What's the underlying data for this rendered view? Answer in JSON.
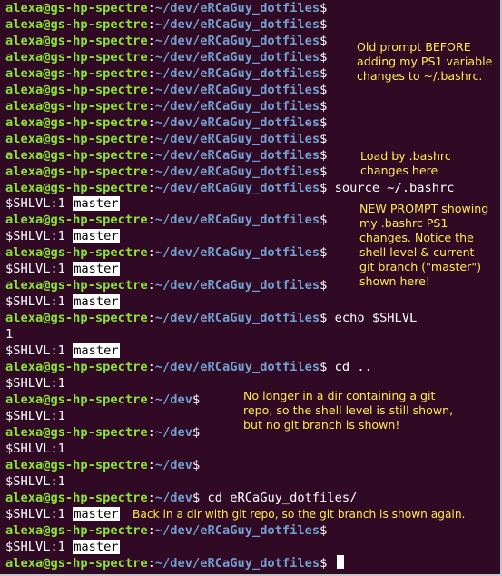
{
  "prompt": {
    "user_host": "alexa@gs-hp-spectre",
    "separator": ":",
    "path_dotfiles": "~/dev/eRCaGuy_dotfiles",
    "path_dev": "~/dev",
    "dollar": "$",
    "shlvl_label": "$SHLVL:1",
    "branch": "master"
  },
  "commands": {
    "source": "source ~/.bashrc",
    "echo": "echo $SHLVL",
    "echo_output": "1",
    "cd_up": "cd ..",
    "cd_dotfiles": "cd eRCaGuy_dotfiles/"
  },
  "annotations": {
    "old_prompt": [
      "Old prompt BEFORE",
      "adding my PS1 variable",
      "changes to ~/.bashrc."
    ],
    "load_bashrc": [
      "Load by .bashrc",
      "changes here"
    ],
    "new_prompt": [
      "NEW PROMPT showing",
      "my .bashrc PS1",
      "changes. Notice the",
      "shell level & current",
      "git branch (\"master\")",
      "shown here!"
    ],
    "no_git": [
      "No longer in a dir containing a git",
      "repo, so the shell level is still shown,",
      "but no git branch is shown!"
    ],
    "back_in_repo": "Back in a dir with git repo, so the git branch is shown again."
  },
  "colors": {
    "background": "#300a24",
    "user_host": "#8ae234",
    "path": "#729fcf",
    "annotation": "#fce94f",
    "text": "#ffffff"
  }
}
